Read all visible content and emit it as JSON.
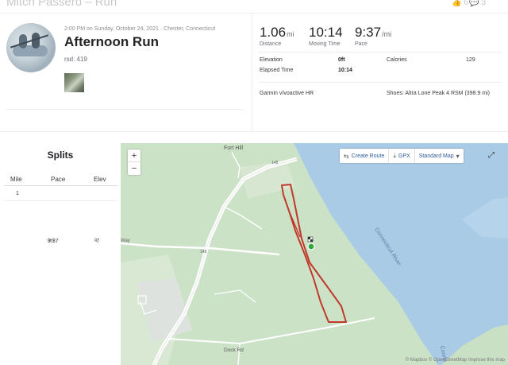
{
  "header": {
    "crumb": "Mitch Passero – Run",
    "kudos_count": "6",
    "comments_count": "3"
  },
  "activity": {
    "date_line": "2:00 PM on Sunday, October 24, 2021 · Chester, Connecticut",
    "title": "Afternoon Run",
    "rsd": "rsd: 419"
  },
  "stats": {
    "distance": {
      "value": "1.06",
      "unit": "mi",
      "label": "Distance"
    },
    "moving_time": {
      "value": "10:14",
      "label": "Moving Time"
    },
    "pace": {
      "value": "9:37",
      "unit": "/mi",
      "label": "Pace"
    }
  },
  "details": {
    "elevation_label": "Elevation",
    "elevation_value": "0ft",
    "calories_label": "Calories",
    "calories_value": "129",
    "elapsed_label": "Elapsed Time",
    "elapsed_value": "10:14",
    "device": "Garmin vívoactive HR",
    "shoes": "Shoes: Altra Lone Peak 4 RSM (398.9 mi)"
  },
  "splits": {
    "title": "Splits",
    "headers": [
      "Mile",
      "Pace",
      "Elev"
    ],
    "rows": [
      {
        "mile": "1",
        "pace": "9:37",
        "pace_unit": "/mi",
        "elev": "-7",
        "elev_unit": "ft"
      }
    ]
  },
  "map": {
    "zoom_in": "+",
    "zoom_out": "−",
    "create_route": "Create Route",
    "gpx": "GPX",
    "map_type": "Standard Map",
    "labels": {
      "fort_hill": "Fort Hill",
      "river": "Connecticut River",
      "dock_rd": "Dock Rd",
      "road_148a": "148",
      "road_148b": "148",
      "way": "Way",
      "river_edge": "Conne"
    },
    "attribution": "© Mapbox © OpenStreetMap Improve this map",
    "colors": {
      "route": "#c0392b",
      "water": "#aacbe6",
      "land": "#cbe2c6"
    }
  }
}
